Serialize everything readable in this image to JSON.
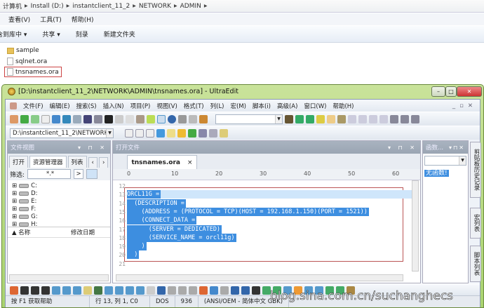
{
  "explorer": {
    "breadcrumb": [
      "计算机",
      "Install (D:)",
      "instantclient_11_2",
      "NETWORK",
      "ADMIN"
    ],
    "menu": [
      "查看(V)",
      "工具(T)",
      "帮助(H)"
    ],
    "toolbar": [
      "包含到库中 ▾",
      "共享 ▾",
      "刻录",
      "新建文件夹"
    ],
    "files": [
      "sample",
      "sqlnet.ora",
      "tnsnames.ora"
    ]
  },
  "ue": {
    "title": "[D:\\instantclient_11_2\\NETWORK\\ADMIN\\tnsnames.ora] - UltraEdit",
    "menu": [
      "文件(F)",
      "编辑(E)",
      "搜索(S)",
      "插入(N)",
      "项目(P)",
      "视图(V)",
      "格式(T)",
      "列(L)",
      "宏(M)",
      "脚本(i)",
      "高级(A)",
      "窗口(W)",
      "帮助(H)"
    ],
    "path_combo": "D:\\instantclient_11_2\\NETWORK",
    "left_panel": {
      "title": "文件视图",
      "tabs": [
        "打开",
        "资源管理器",
        "列表"
      ],
      "filter_label": "筛选:",
      "filter_value": "*.*",
      "drives": [
        "C:",
        "D:",
        "E:",
        "F:",
        "G:",
        "H:"
      ],
      "columns": [
        "名称",
        "修改日期"
      ]
    },
    "editor": {
      "panel_title": "打开文件",
      "tab": "tnsnames.ora",
      "ruler": [
        "0",
        "10",
        "20",
        "30",
        "40",
        "50",
        "60"
      ],
      "lines": [
        {
          "n": "12",
          "t": ""
        },
        {
          "n": "13",
          "t": "ORCL11G ="
        },
        {
          "n": "14",
          "t": "  (DESCRIPTION ="
        },
        {
          "n": "15",
          "t": "    (ADDRESS = (PROTOCOL = TCP)(HOST = 192.168.1.150)(PORT = 1521))"
        },
        {
          "n": "16",
          "t": "    (CONNECT_DATA ="
        },
        {
          "n": "17",
          "t": "      (SERVER = DEDICATED)"
        },
        {
          "n": "18",
          "t": "      (SERVICE_NAME = orcl11g)"
        },
        {
          "n": "19",
          "t": "    )"
        },
        {
          "n": "20",
          "t": "  )"
        },
        {
          "n": "21",
          "t": ""
        }
      ]
    },
    "right_panel": {
      "title": "函数...",
      "empty": "无函数!",
      "side_tabs": [
        "剪贴板历史记录",
        "宏列表",
        "脚本列表"
      ]
    },
    "status": [
      "按 F1 获取帮助",
      "行 13, 列 1, C0",
      "DOS",
      "936",
      "(ANSI/OEM - 简体中文 GBK)"
    ]
  },
  "watermark": "blog.sina.com.cn/suchanghecs"
}
